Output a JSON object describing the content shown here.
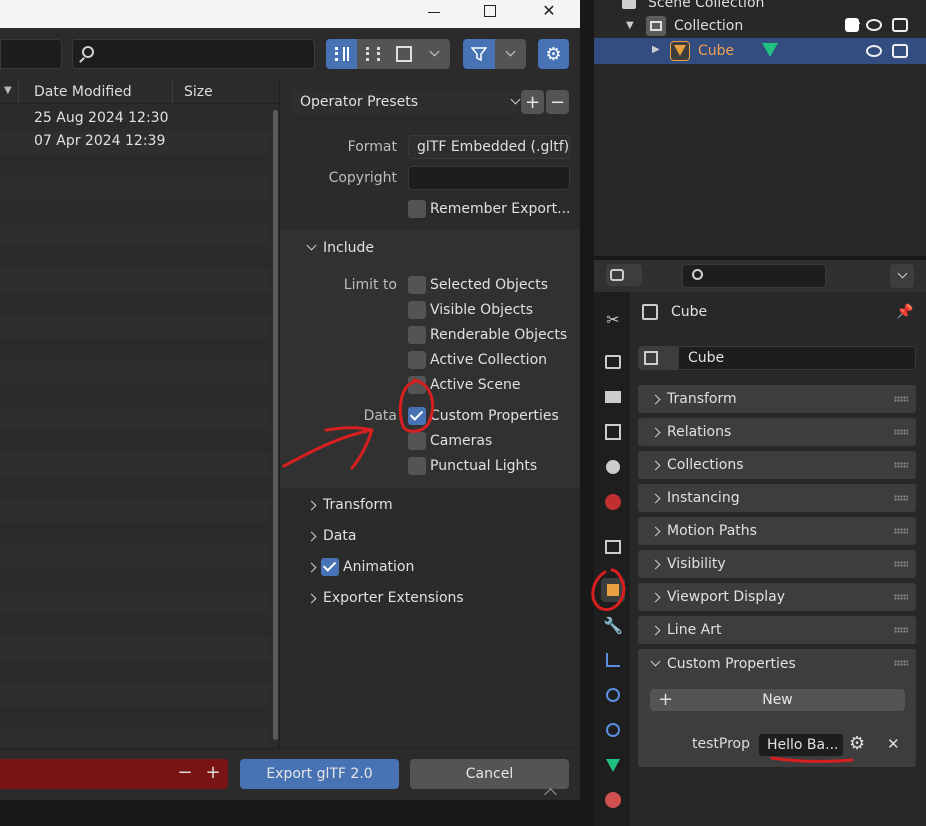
{
  "file_browser": {
    "columns": {
      "date_modified": "Date Modified",
      "size": "Size"
    },
    "rows": [
      {
        "date": "25 Aug 2024 12:30",
        "size": ""
      },
      {
        "date": "07 Apr 2024 12:39",
        "size": ""
      }
    ]
  },
  "export_settings": {
    "operator_presets": "Operator Presets",
    "format_label": "Format",
    "format_value": "glTF Embedded (.gltf)",
    "copyright_label": "Copyright",
    "copyright_value": "",
    "remember_export": "Remember Export...",
    "include_header": "Include",
    "limit_to_label": "Limit to",
    "limit_to": [
      "Selected Objects",
      "Visible Objects",
      "Renderable Objects",
      "Active Collection",
      "Active Scene"
    ],
    "data_label": "Data",
    "data_options": [
      {
        "label": "Custom Properties",
        "checked": true
      },
      {
        "label": "Cameras",
        "checked": false
      },
      {
        "label": "Punctual Lights",
        "checked": false
      }
    ],
    "sections": [
      {
        "label": "Transform",
        "checked": null
      },
      {
        "label": "Data",
        "checked": null
      },
      {
        "label": "Animation",
        "checked": true
      },
      {
        "label": "Exporter Extensions",
        "checked": null
      }
    ],
    "export_button": "Export glTF 2.0",
    "cancel_button": "Cancel"
  },
  "outliner": {
    "scene_collection": "Scene Collection",
    "collection": "Collection",
    "cube": "Cube"
  },
  "properties": {
    "object_name": "Cube",
    "datablock_name": "Cube",
    "panels": [
      "Transform",
      "Relations",
      "Collections",
      "Instancing",
      "Motion Paths",
      "Visibility",
      "Viewport Display",
      "Line Art"
    ],
    "custom_properties": "Custom Properties",
    "new_button": "New",
    "prop_name": "testProp",
    "prop_value": "Hello Ba..."
  },
  "colors": {
    "accent": "#4772b3",
    "active_row": "#334d80",
    "annotation": "#d81f1f",
    "cube_orange": "#e8a040"
  }
}
